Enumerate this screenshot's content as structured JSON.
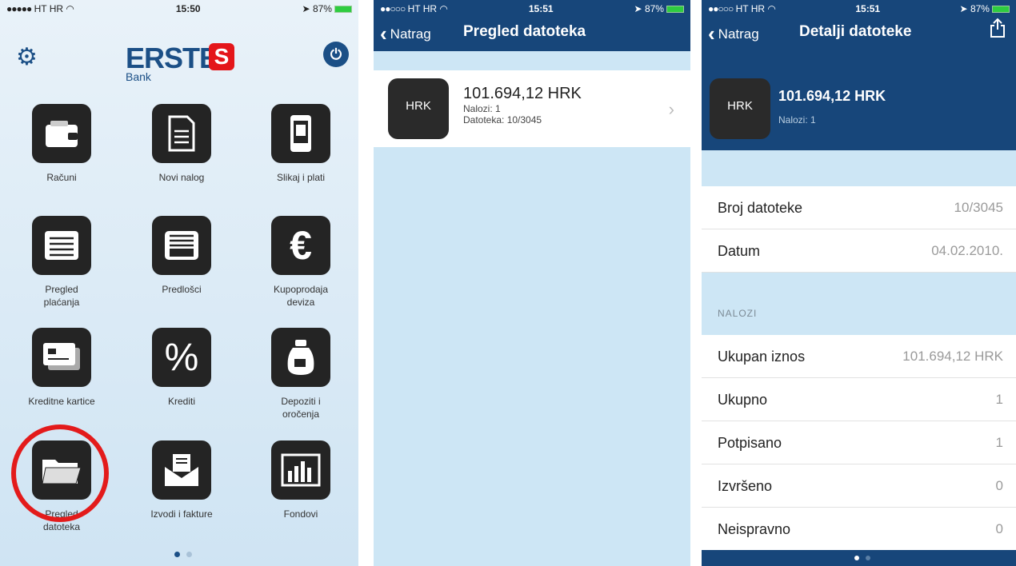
{
  "screen1": {
    "status": {
      "carrier": "HT HR",
      "time": "15:50",
      "battery": "87%"
    },
    "logo": {
      "name": "ERSTE",
      "sub": "Bank"
    },
    "tiles": [
      {
        "label": "Računi",
        "icon": "wallet-icon"
      },
      {
        "label": "Novi nalog",
        "icon": "document-icon"
      },
      {
        "label": "Slikaj i plati",
        "icon": "phone-camera-icon"
      },
      {
        "label": "Pregled plaćanja",
        "icon": "list-icon"
      },
      {
        "label": "Predlošci",
        "icon": "inbox-tray-icon"
      },
      {
        "label": "Kupoprodaja deviza",
        "icon": "euro-icon"
      },
      {
        "label": "Kreditne kartice",
        "icon": "credit-card-icon"
      },
      {
        "label": "Krediti",
        "icon": "percent-icon"
      },
      {
        "label": "Depoziti i oročenja",
        "icon": "money-bag-icon"
      },
      {
        "label": "Pregled datoteka",
        "icon": "folder-icon"
      },
      {
        "label": "Izvodi i fakture",
        "icon": "envelope-icon"
      },
      {
        "label": "Fondovi",
        "icon": "bar-chart-icon"
      }
    ]
  },
  "screen2": {
    "status": {
      "carrier": "HT HR",
      "time": "15:51",
      "battery": "87%"
    },
    "nav": {
      "back": "Natrag",
      "title": "Pregled datoteka"
    },
    "item": {
      "currency": "HRK",
      "amount": "101.694,12 HRK",
      "nalozi": "Nalozi: 1",
      "datoteka": "Datoteka: 10/3045"
    }
  },
  "screen3": {
    "status": {
      "carrier": "HT HR",
      "time": "15:51",
      "battery": "87%"
    },
    "nav": {
      "back": "Natrag",
      "title": "Detalji datoteke"
    },
    "header": {
      "currency": "HRK",
      "amount": "101.694,12 HRK",
      "nalozi": "Nalozi: 1"
    },
    "info": [
      {
        "k": "Broj datoteke",
        "v": "10/3045"
      },
      {
        "k": "Datum",
        "v": "04.02.2010."
      }
    ],
    "section": "NALOZI",
    "orders": [
      {
        "k": "Ukupan iznos",
        "v": "101.694,12 HRK"
      },
      {
        "k": "Ukupno",
        "v": "1"
      },
      {
        "k": "Potpisano",
        "v": "1"
      },
      {
        "k": "Izvršeno",
        "v": "0"
      },
      {
        "k": "Neispravno",
        "v": "0"
      }
    ]
  },
  "colors": {
    "navy": "#17467a",
    "red": "#e4161a",
    "highlight": "#e31b1b"
  }
}
